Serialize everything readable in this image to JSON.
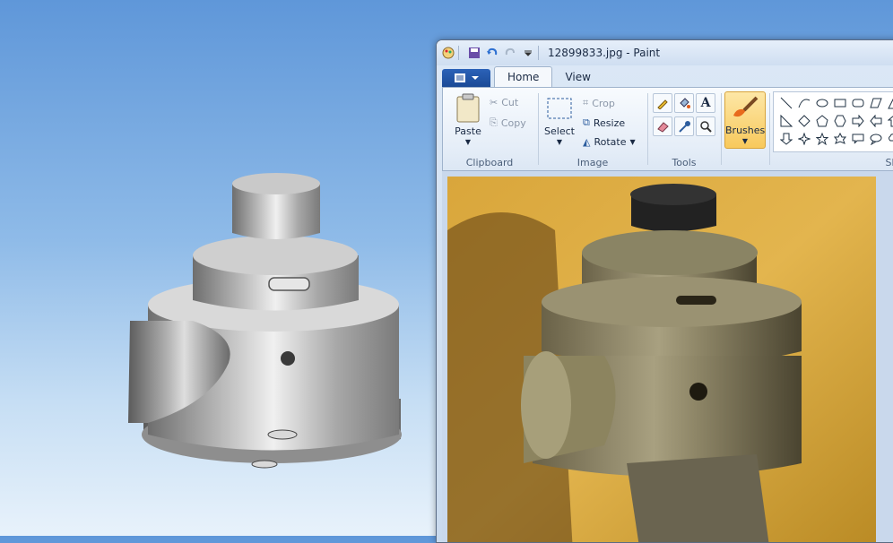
{
  "window": {
    "title": "12899833.jpg - Paint"
  },
  "tabs": [
    {
      "label": "Home",
      "active": true
    },
    {
      "label": "View",
      "active": false
    }
  ],
  "clipboard": {
    "paste_label": "Paste",
    "cut_label": "Cut",
    "copy_label": "Copy",
    "group_label": "Clipboard"
  },
  "image": {
    "select_label": "Select",
    "crop_label": "Crop",
    "resize_label": "Resize",
    "rotate_label": "Rotate",
    "group_label": "Image"
  },
  "tools": {
    "group_label": "Tools",
    "items": [
      "pencil-icon",
      "fill-icon",
      "text-icon",
      "eraser-icon",
      "color-picker-icon",
      "magnifier-icon"
    ]
  },
  "brushes": {
    "label": "Brushes"
  },
  "shapes": {
    "group_label": "Shape"
  },
  "colors": {
    "accent_active": "#f8c95c",
    "app_menu_blue": "#2b62b8"
  }
}
